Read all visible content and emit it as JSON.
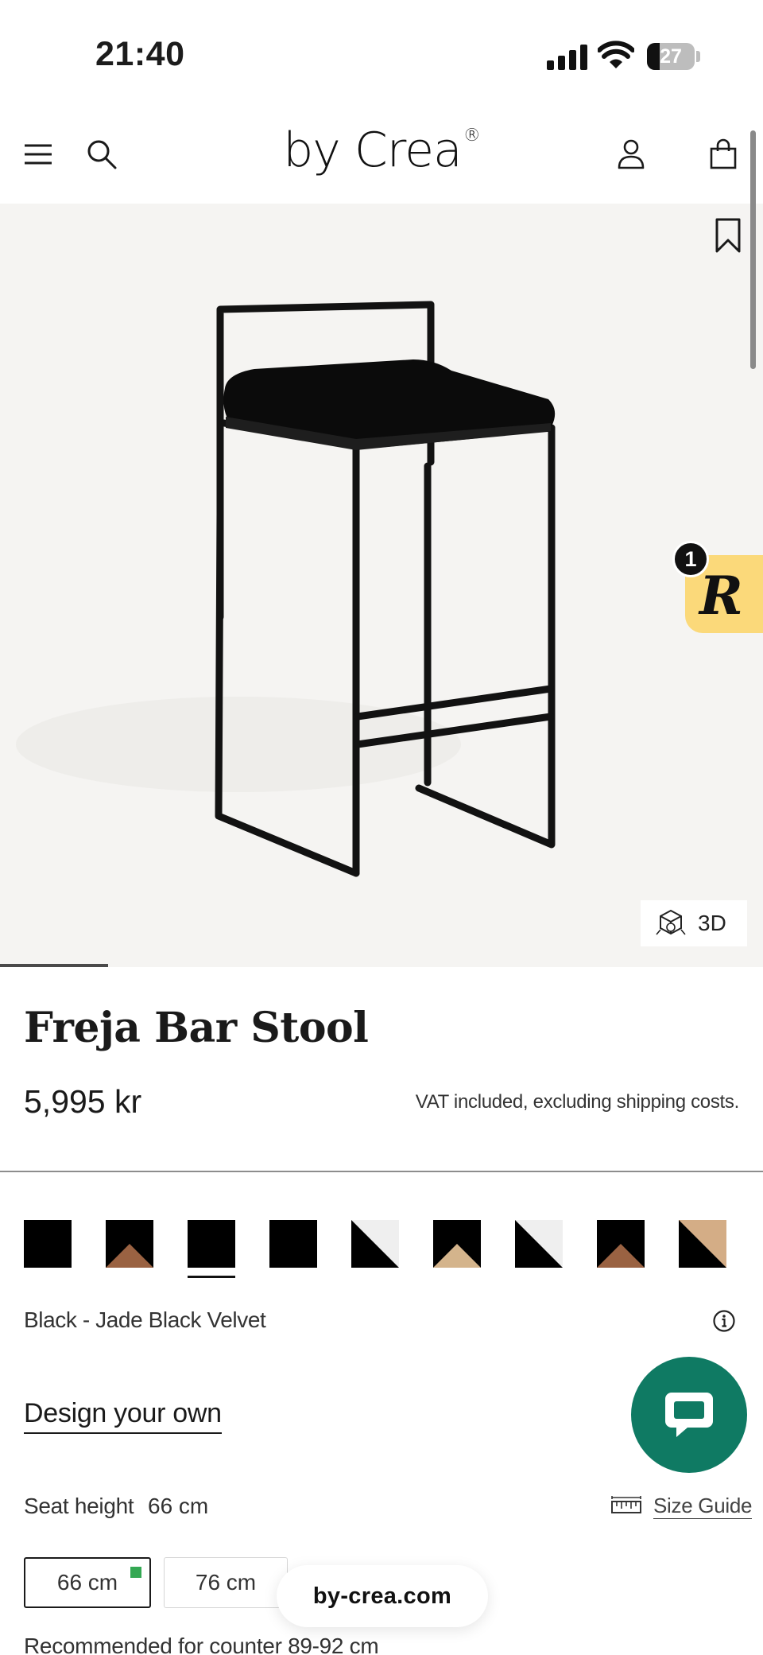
{
  "status_bar": {
    "time": "21:40",
    "battery_percent": "27",
    "battery_level": 0.27
  },
  "header": {
    "logo_text": "by Crea",
    "logo_mark": "®",
    "icons": [
      "menu-icon",
      "search-icon",
      "account-icon",
      "cart-icon"
    ]
  },
  "hero": {
    "image_subject": "black metal bar stool with black velvet seat",
    "view_3d_label": "3D",
    "badge_count": "1",
    "badge_letter": "R",
    "badge_color": "#fbd97a",
    "gallery_progress": 0.142
  },
  "product": {
    "title": "Freja Bar Stool",
    "price": "5,995 kr",
    "vat_note": "VAT included, excluding shipping costs."
  },
  "swatches": [
    {
      "top": "#000000",
      "bottom": "#000000",
      "style": "solid",
      "selected": false
    },
    {
      "top": "#000000",
      "bottom": "#9a6242",
      "style": "peak",
      "selected": false
    },
    {
      "top": "#000000",
      "bottom": "#000000",
      "style": "solid",
      "selected": true
    },
    {
      "top": "#000000",
      "bottom": "#000000",
      "style": "solid",
      "selected": false
    },
    {
      "top": "#efefef",
      "bottom": "#000000",
      "style": "diag",
      "selected": false
    },
    {
      "top": "#000000",
      "bottom": "#d4b48c",
      "style": "peak",
      "selected": false
    },
    {
      "top": "#efefef",
      "bottom": "#000000",
      "style": "diag",
      "selected": false
    },
    {
      "top": "#000000",
      "bottom": "#9a6242",
      "style": "peak",
      "selected": false
    },
    {
      "top": "#d4ad86",
      "bottom": "#000000",
      "style": "diag",
      "selected": false
    }
  ],
  "selection": {
    "color_name": "Black - Jade Black Velvet",
    "design_own_link": "Design your own"
  },
  "seat_height": {
    "label": "Seat height",
    "value": "66 cm",
    "size_guide_link": "Size Guide",
    "options": [
      "66 cm",
      "76 cm"
    ],
    "recommendation": "Recommended for counter 89-92 cm"
  },
  "browser": {
    "url": "by-crea.com"
  },
  "colors": {
    "chat_button": "#0f7a63",
    "accent": "#1a1a1a"
  }
}
